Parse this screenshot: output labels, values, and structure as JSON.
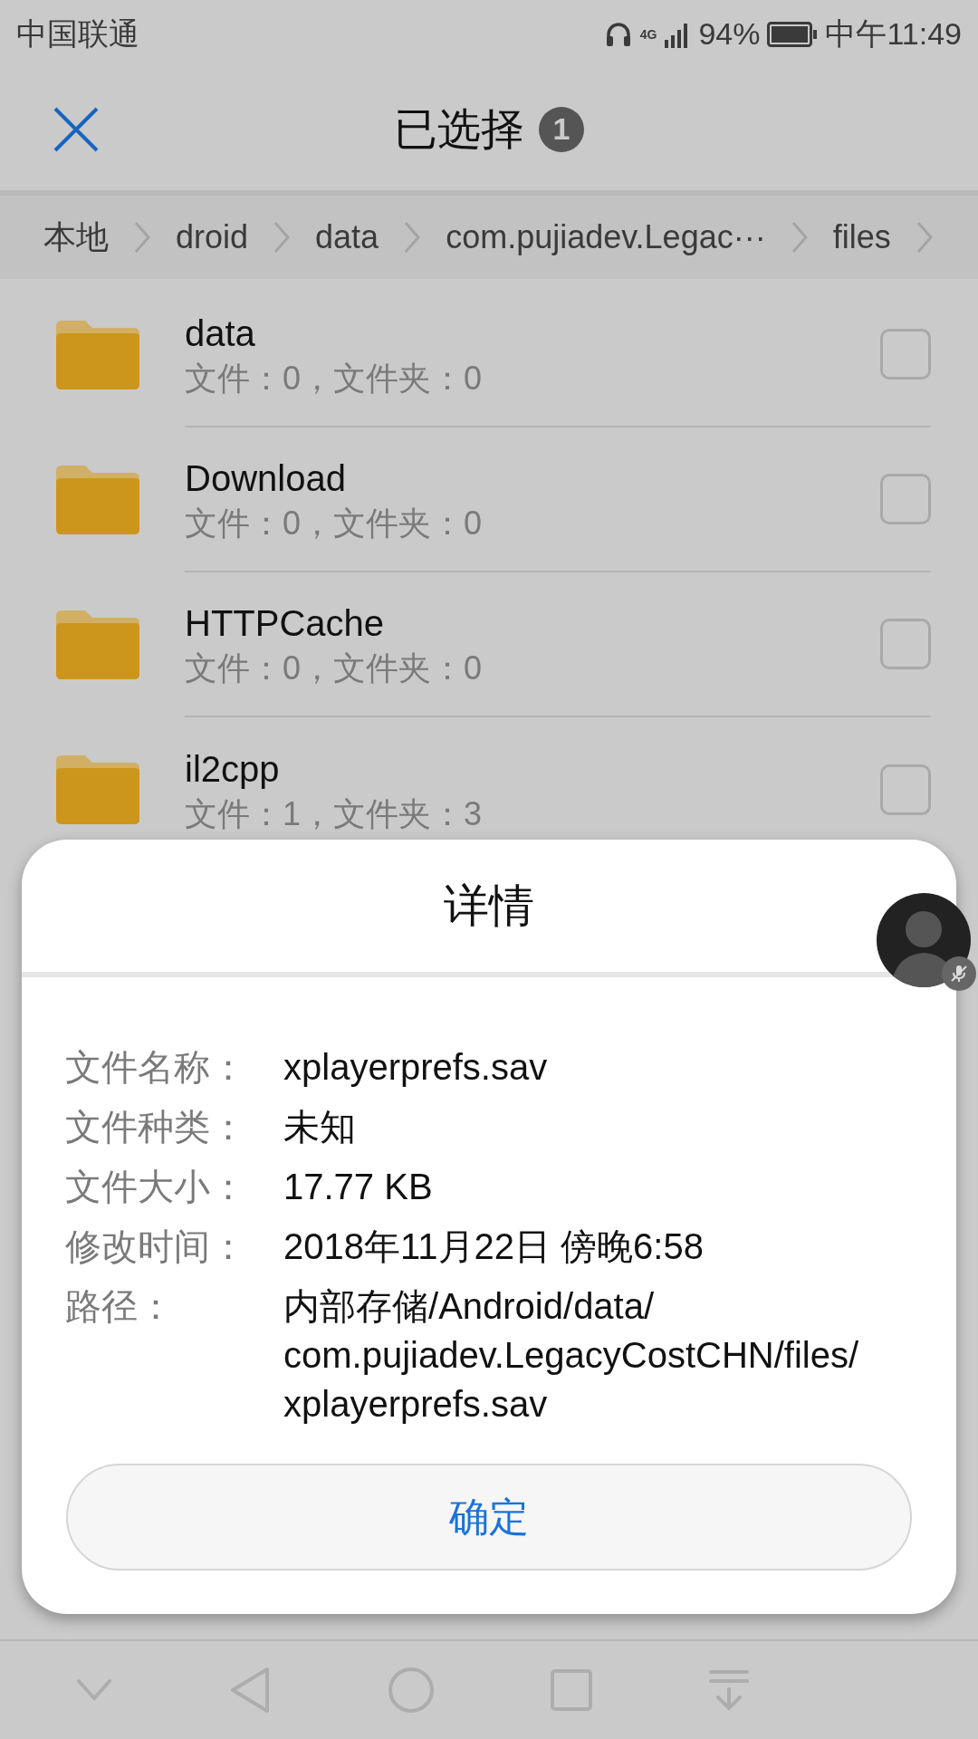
{
  "status_bar": {
    "carrier": "中国联通",
    "network": "4G",
    "battery": "94%",
    "time": "中午11:49"
  },
  "header": {
    "title": "已选择",
    "count": "1"
  },
  "breadcrumb": [
    "本地",
    "droid",
    "data",
    "com.pujiadev.Legac···",
    "files"
  ],
  "files": [
    {
      "name": "data",
      "info": "文件：0，文件夹：0",
      "checked": false
    },
    {
      "name": "Download",
      "info": "文件：0，文件夹：0",
      "checked": false
    },
    {
      "name": "HTTPCache",
      "info": "文件：0，文件夹：0",
      "checked": false
    },
    {
      "name": "il2cpp",
      "info": "文件：1，文件夹：3",
      "checked": false
    }
  ],
  "dialog": {
    "title": "详情",
    "fields": [
      {
        "label": "文件名称：",
        "value": "xplayerprefs.sav"
      },
      {
        "label": "文件种类：",
        "value": "未知"
      },
      {
        "label": "文件大小：",
        "value": "17.77 KB"
      },
      {
        "label": "修改时间：",
        "value": "2018年11月22日 傍晚6:58"
      },
      {
        "label": "路径：",
        "value": "内部存储/Android/data/com.pujiadev.LegacyCostCHN/files/xplayerprefs.sav"
      }
    ],
    "ok": "确定"
  }
}
